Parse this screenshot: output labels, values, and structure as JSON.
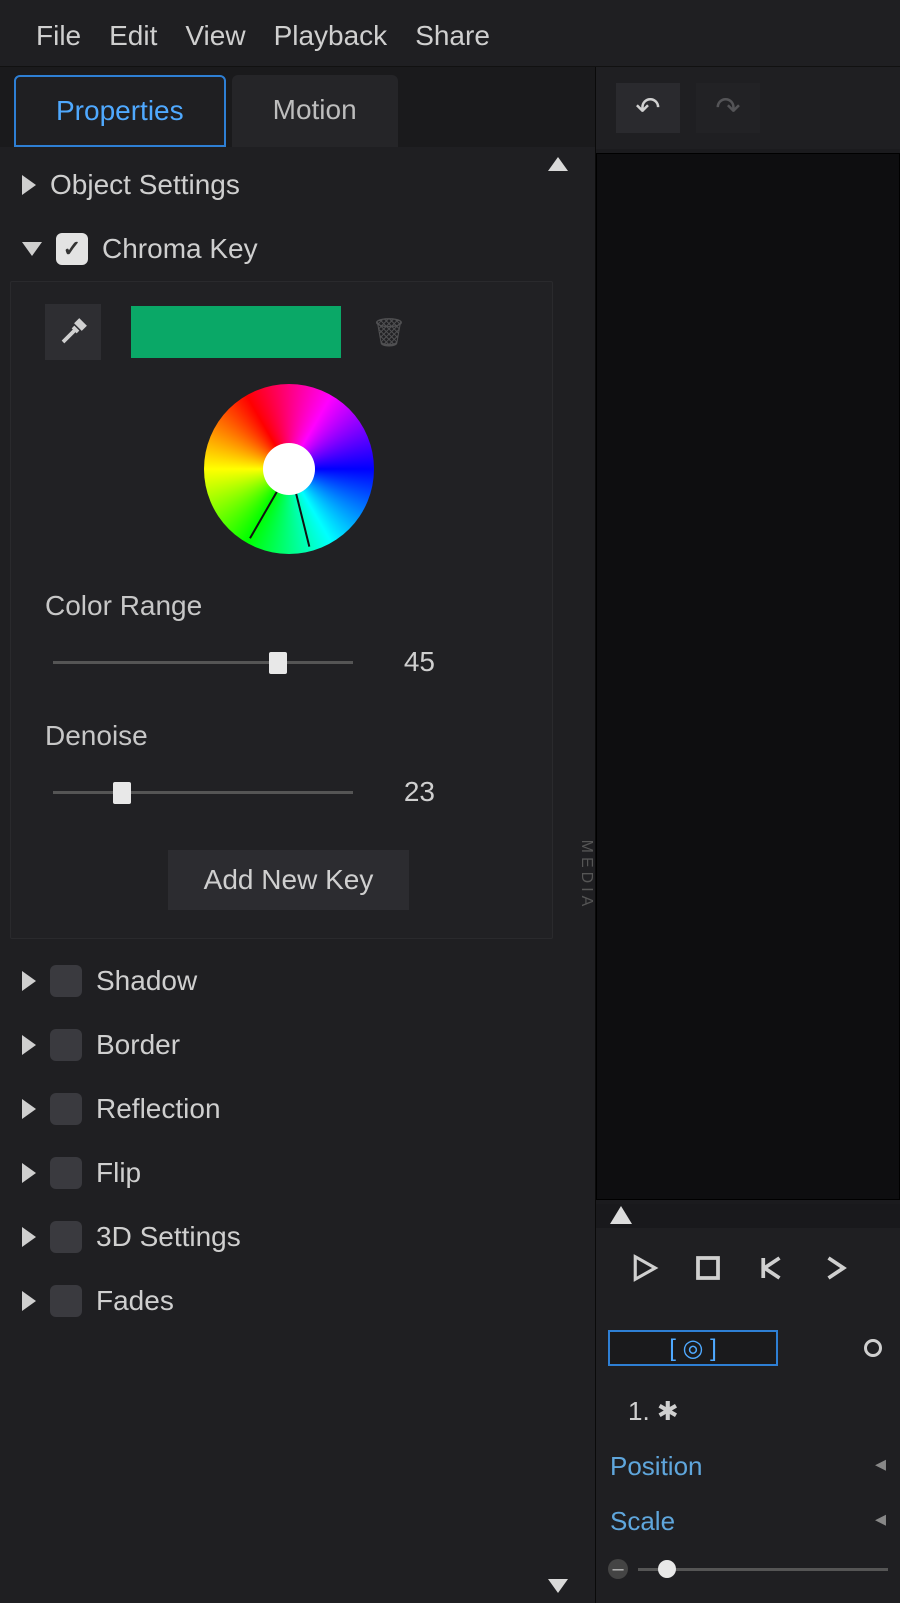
{
  "menu": [
    "File",
    "Edit",
    "View",
    "Playback",
    "Share"
  ],
  "tabs": {
    "properties": "Properties",
    "motion": "Motion",
    "active": "properties"
  },
  "sections": {
    "object_settings": "Object Settings",
    "chroma_key": "Chroma Key",
    "shadow": "Shadow",
    "border": "Border",
    "reflection": "Reflection",
    "flip": "Flip",
    "three_d_settings": "3D Settings",
    "fades": "Fades"
  },
  "chroma": {
    "swatch_color": "#0aa867",
    "color_range_label": "Color Range",
    "color_range_value": "45",
    "denoise_label": "Denoise",
    "denoise_value": "23",
    "add_new_key": "Add New Key"
  },
  "timeline": {
    "kf_marker": "[ ◎ ]",
    "track_label": "1. ✱",
    "position": "Position",
    "scale": "Scale"
  }
}
